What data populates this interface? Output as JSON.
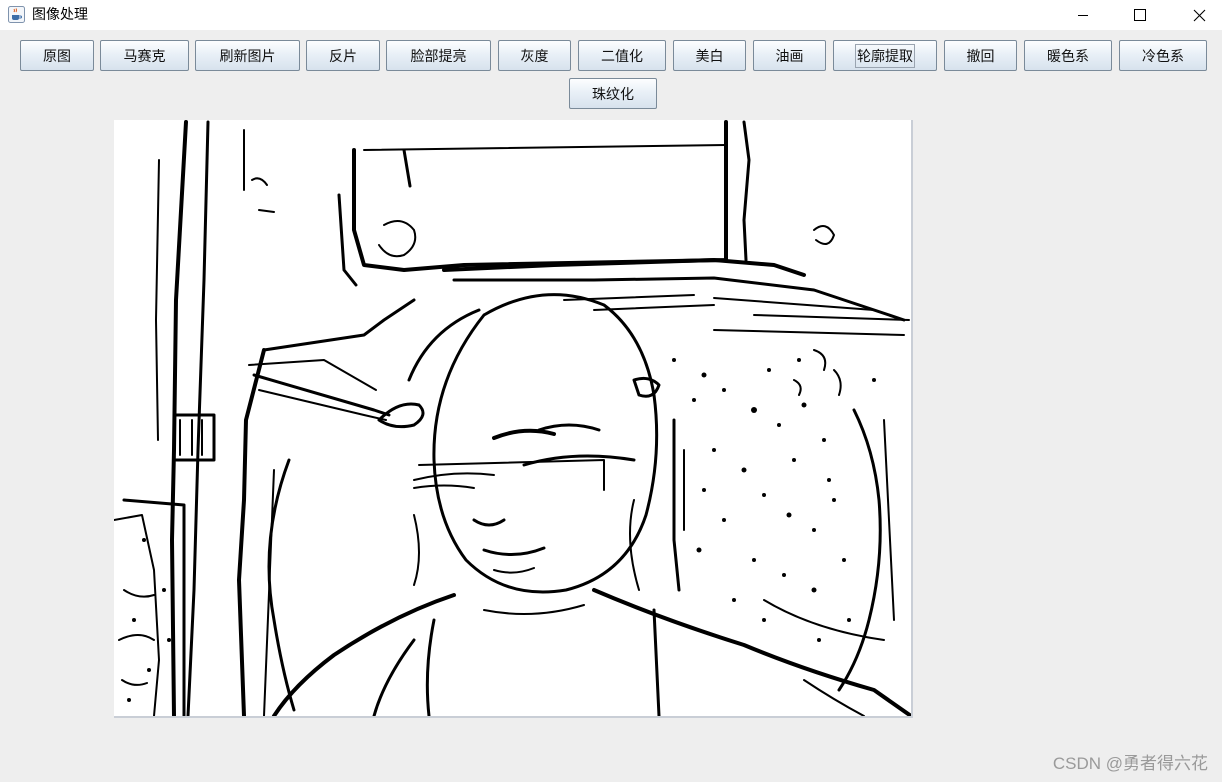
{
  "window": {
    "title": "图像处理",
    "app_icon": "java-cup-icon",
    "controls": {
      "minimize": "minimize-icon",
      "maximize": "maximize-icon",
      "close": "close-icon"
    }
  },
  "toolbar": {
    "buttons": [
      {
        "label": "原图"
      },
      {
        "label": "马赛克"
      },
      {
        "label": "刷新图片"
      },
      {
        "label": "反片"
      },
      {
        "label": "脸部提亮"
      },
      {
        "label": "灰度"
      },
      {
        "label": "二值化"
      },
      {
        "label": "美白"
      },
      {
        "label": "油画"
      },
      {
        "label": "轮廓提取"
      },
      {
        "label": "撤回"
      },
      {
        "label": "暖色系"
      },
      {
        "label": "冷色系"
      },
      {
        "label": "珠纹化"
      }
    ],
    "focused_button": "轮廓提取"
  },
  "canvas": {
    "content": "contour-extracted-photo",
    "colors": {
      "background": "#ffffff",
      "stroke": "#000000"
    }
  },
  "watermark": "CSDN @勇者得六花"
}
